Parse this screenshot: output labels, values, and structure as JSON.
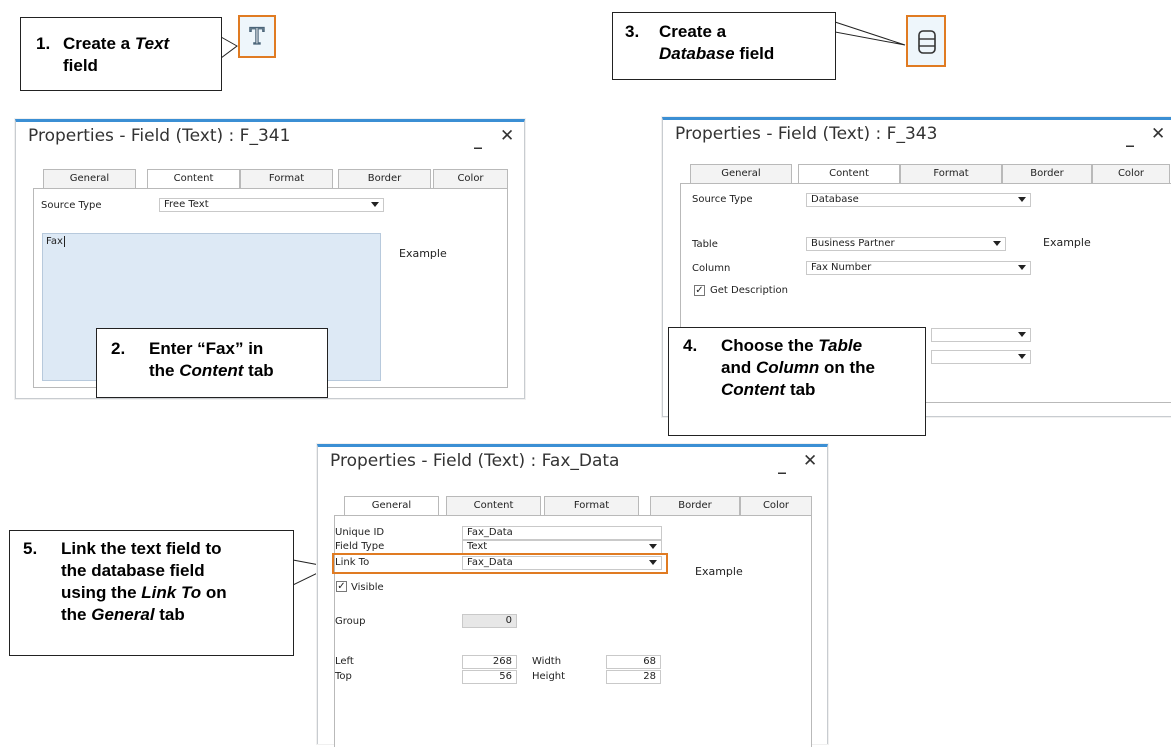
{
  "callouts": {
    "c1": {
      "num": "1.",
      "line1_prefix": "Create a ",
      "line1_italic": "Text",
      "line2": "field"
    },
    "c2": {
      "num": "2.",
      "line1": "Enter “Fax” in",
      "line2_prefix": "the ",
      "line2_italic": "Content",
      "line2_suffix": " tab"
    },
    "c3": {
      "num": "3.",
      "line1": "Create a",
      "line2_italic": "Database",
      "line2_suffix": " field"
    },
    "c4": {
      "num": "4.",
      "line1_prefix": "Choose the ",
      "line1_italic": "Table",
      "line2_prefix": "and ",
      "line2_italic": "Column",
      "line2_suffix": " on the",
      "line3_italic": "Content",
      "line3_suffix": " tab"
    },
    "c5": {
      "num": "5.",
      "line1": "Link the text field to",
      "line2": "the database field",
      "line3_prefix": "using the ",
      "line3_italic": "Link To",
      "line3_suffix": " on",
      "line4_prefix": "the ",
      "line4_italic": "General",
      "line4_suffix": " tab"
    }
  },
  "icons": {
    "text_tool": "T",
    "database_tool": "database-icon"
  },
  "accent_color": "#e07b22",
  "dialog1": {
    "title": "Properties - Field (Text) : F_341",
    "minimize": "_",
    "close": "✕",
    "tabs": [
      "General",
      "Content",
      "Format",
      "Border",
      "Color"
    ],
    "source_type_label": "Source Type",
    "source_type_value": "Free Text",
    "content_text": "Fax",
    "example": "Example"
  },
  "dialog2": {
    "title": "Properties - Field (Text) : F_343",
    "minimize": "_",
    "close": "✕",
    "tabs": [
      "General",
      "Content",
      "Format",
      "Border",
      "Color"
    ],
    "source_type_label": "Source Type",
    "source_type_value": "Database",
    "table_label": "Table",
    "table_value": "Business Partner",
    "column_label": "Column",
    "column_value": "Fax Number",
    "get_description": "Get Description",
    "example": "Example"
  },
  "dialog3": {
    "title": "Properties - Field (Text) : Fax_Data",
    "minimize": "_",
    "close": "✕",
    "tabs": [
      "General",
      "Content",
      "Format",
      "Border",
      "Color"
    ],
    "unique_id_label": "Unique ID",
    "unique_id_value": "Fax_Data",
    "field_type_label": "Field Type",
    "field_type_value": "Text",
    "link_to_label": "Link To",
    "link_to_value": "Fax_Data",
    "visible_label": "Visible",
    "group_label": "Group",
    "group_value": "0",
    "left_label": "Left",
    "left_value": "268",
    "top_label": "Top",
    "top_value": "56",
    "width_label": "Width",
    "width_value": "68",
    "height_label": "Height",
    "height_value": "28",
    "example": "Example"
  }
}
